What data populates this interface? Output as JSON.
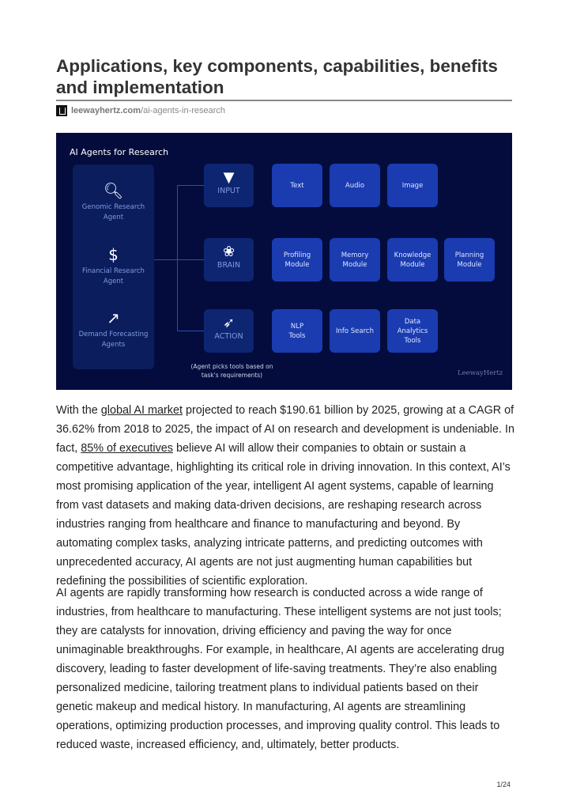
{
  "title": "Applications, key components, capabilities, benefits and implementation",
  "source": {
    "domain": "leewayhertz.com",
    "path": "/ai-agents-in-research"
  },
  "figure": {
    "title": "AI Agents for Research",
    "agents": [
      {
        "icon": "dna-magnifier-icon",
        "label": "Genomic Research Agent"
      },
      {
        "icon": "dollar-magnifier-icon",
        "label": "Financial Research Agent"
      },
      {
        "icon": "chart-growth-icon",
        "label": "Demand Forecasting Agents"
      }
    ],
    "rows": [
      {
        "label": "INPUT",
        "icon": "funnel-icon",
        "items": [
          "Text",
          "Audio",
          "Image"
        ]
      },
      {
        "label": "BRAIN",
        "icon": "brain-icon",
        "items": [
          "Profiling\nModule",
          "Memory\nModule",
          "Knowledge\nModule",
          "Planning\nModule"
        ]
      },
      {
        "label": "ACTION",
        "icon": "target-arrow-icon",
        "items": [
          "NLP\nTools",
          "Info Search",
          "Data\nAnalytics\nTools"
        ]
      }
    ],
    "note": "(Agent picks tools based on task's requirements)",
    "watermark": "LeewayHertz",
    "colors": {
      "background": "#030c3c",
      "panel": "#0b1d5c",
      "category": "#0e2572",
      "item": "#1a3cb0"
    }
  },
  "p1": {
    "t1": "With the ",
    "link1": "global AI market",
    "t2": " projected to reach $190.61 billion by 2025, growing at a CAGR of 36.62% from 2018 to 2025, the impact of AI on research and development is undeniable. In fact, ",
    "link2": "85% of executives",
    "t3": " believe AI will allow their companies to obtain or sustain a competitive advantage, highlighting its critical role in driving innovation. In this context, AI’s most promising application of the year, intelligent AI agent systems, capable of learning from vast datasets and making data-driven decisions, are reshaping research across industries ranging from healthcare and finance to manufacturing and beyond. By automating complex tasks, analyzing intricate patterns, and predicting outcomes with unprecedented accuracy, AI agents are not just augmenting human capabilities but redefining the possibilities of scientific exploration."
  },
  "p2": "AI agents are rapidly transforming how research is conducted across a wide range of industries, from healthcare to manufacturing. These intelligent systems are not just tools; they are catalysts for innovation, driving efficiency and paving the way for once unimaginable breakthroughs. For example, in healthcare, AI agents are accelerating drug discovery, leading to faster development of life-saving treatments. They’re also enabling personalized medicine, tailoring treatment plans to individual patients based on their genetic makeup and medical history. In manufacturing, AI agents are streamlining operations, optimizing production processes, and improving quality control. This leads to reduced waste, increased efficiency, and, ultimately, better products.",
  "page": "1/24"
}
